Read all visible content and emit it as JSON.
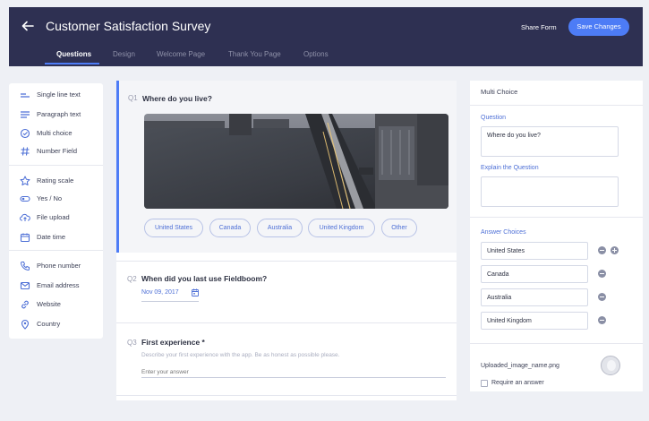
{
  "header": {
    "title": "Customer Satisfaction Survey",
    "share_label": "Share Form",
    "save_label": "Save Changes",
    "accent_color": "#4d7cf6",
    "background_color": "#2e3052"
  },
  "tabs": [
    {
      "label": "Questions",
      "active": true
    },
    {
      "label": "Design",
      "active": false
    },
    {
      "label": "Welcome Page",
      "active": false
    },
    {
      "label": "Thank You Page",
      "active": false
    },
    {
      "label": "Options",
      "active": false
    }
  ],
  "sidebar": {
    "items": [
      {
        "label": "Single line text",
        "icon": "short-text-icon"
      },
      {
        "label": "Paragraph text",
        "icon": "paragraph-icon"
      },
      {
        "label": "Multi choice",
        "icon": "check-circle-icon"
      },
      {
        "label": "Number Field",
        "icon": "hash-icon"
      },
      {
        "label": "Rating scale",
        "icon": "star-icon"
      },
      {
        "label": "Yes / No",
        "icon": "toggle-icon"
      },
      {
        "label": "File upload",
        "icon": "cloud-upload-icon"
      },
      {
        "label": "Date time",
        "icon": "calendar-icon"
      },
      {
        "label": "Phone number",
        "icon": "phone-icon"
      },
      {
        "label": "Email address",
        "icon": "email-icon"
      },
      {
        "label": "Website",
        "icon": "globe-icon"
      },
      {
        "label": "Country",
        "icon": "map-pin-icon"
      }
    ]
  },
  "questions": [
    {
      "number": "Q1",
      "text": "Where do you live?",
      "choices": [
        "United States",
        "Canada",
        "Australia",
        "United Kingdom",
        "Other"
      ]
    },
    {
      "number": "Q2",
      "text": "When did you last use Fieldboom?",
      "date_value": "Nov 09, 2017"
    },
    {
      "number": "Q3",
      "text": "First experience *",
      "description": "Describe your first experience with the app. Be as honest as possible please.",
      "placeholder": "Enter your answer"
    }
  ],
  "panel": {
    "title": "Multi Choice",
    "question_label": "Question",
    "question_value": "Where do you live?",
    "explain_label": "Explain the Question",
    "explain_value": "",
    "choices_label": "Answer Choices",
    "choices": [
      "United States",
      "Canada",
      "Australia",
      "United Kingdom"
    ],
    "file_name": "Uploaded_image_name.png",
    "require_label": "Require an answer",
    "require_checked": false
  }
}
